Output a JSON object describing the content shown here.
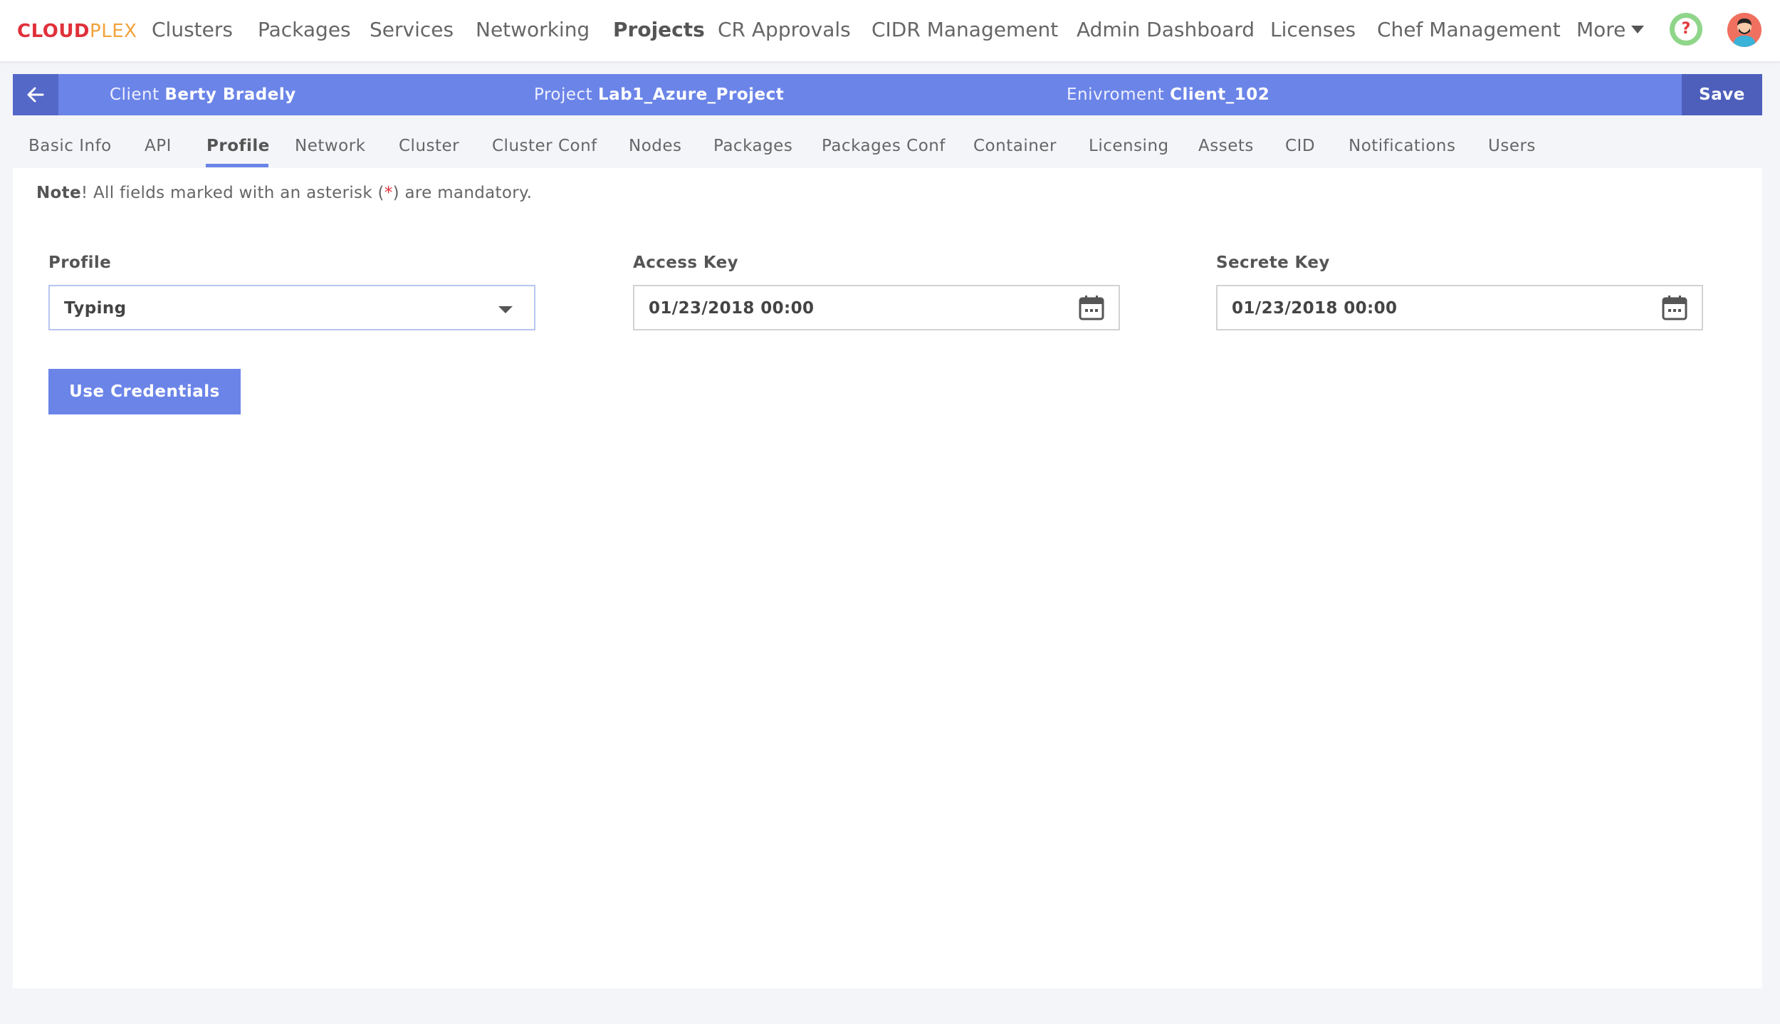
{
  "brand": {
    "part1": "CLOUD",
    "part2": "PLEX"
  },
  "nav": {
    "items": [
      "Clusters",
      "Packages",
      "Services",
      "Networking",
      "Projects",
      "CR Approvals",
      "CIDR Management",
      "Admin Dashboard",
      "Licenses",
      "Chef Management",
      "More"
    ],
    "help_icon": "question-circle-icon",
    "avatar_icon": "user-avatar-icon"
  },
  "project_bar": {
    "client_label": "Client",
    "client_value": "Berty Bradely",
    "project_label": "Project",
    "project_value": "Lab1_Azure_Project",
    "env_label": "Enivroment",
    "env_value": "Client_102",
    "save_label": "Save",
    "back_icon": "arrow-left-icon"
  },
  "tabs": [
    "Basic Info",
    "API",
    "Profile",
    "Network",
    "Cluster",
    "Cluster Conf",
    "Nodes",
    "Packages",
    "Packages Conf",
    "Container",
    "Licensing",
    "Assets",
    "CID",
    "Notifications",
    "Users"
  ],
  "active_tab": "Profile",
  "note": {
    "prefix": "Note",
    "text_before": "! All fields marked with an asterisk (",
    "asterisk": "*",
    "text_after": ") are mandatory."
  },
  "form": {
    "profile": {
      "label": "Profile",
      "value": "Typing"
    },
    "access_key": {
      "label": "Access Key",
      "value": "01/23/2018 00:00"
    },
    "secret_key": {
      "label": "Secrete Key",
      "value": "01/23/2018 00:00"
    },
    "use_credentials_label": "Use Credentials"
  },
  "colors": {
    "accent": "#6b84e8",
    "accent_dark": "#4e5fbb",
    "brand_red": "#e0303a",
    "brand_orange": "#f2a23a",
    "help_green": "#8fd58a"
  }
}
